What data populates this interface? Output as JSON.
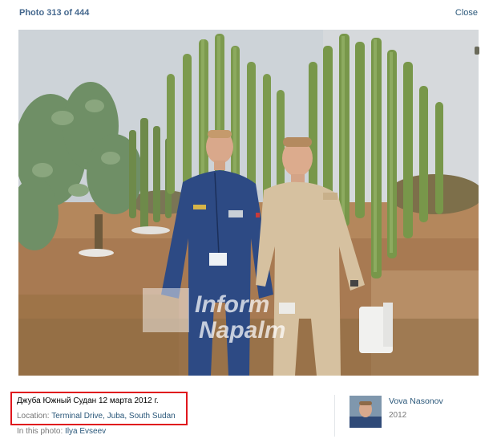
{
  "header": {
    "counter": "Photo 313 of 444",
    "close_label": "Close"
  },
  "photo": {
    "watermark_line1": "Inform",
    "watermark_line2": "Napalm"
  },
  "caption": {
    "text": "Джуба Южный Судан 12 марта 2012 г.",
    "location_label": "Location:",
    "location_link": "Terminal Drive, Juba, South Sudan",
    "in_photo_label": "In this photo:",
    "in_photo_person": "Ilya Evseev"
  },
  "author": {
    "name": "Vova Nasonov",
    "year": "2012"
  },
  "colors": {
    "link": "#2b587a",
    "highlight_border": "#e0161d"
  }
}
